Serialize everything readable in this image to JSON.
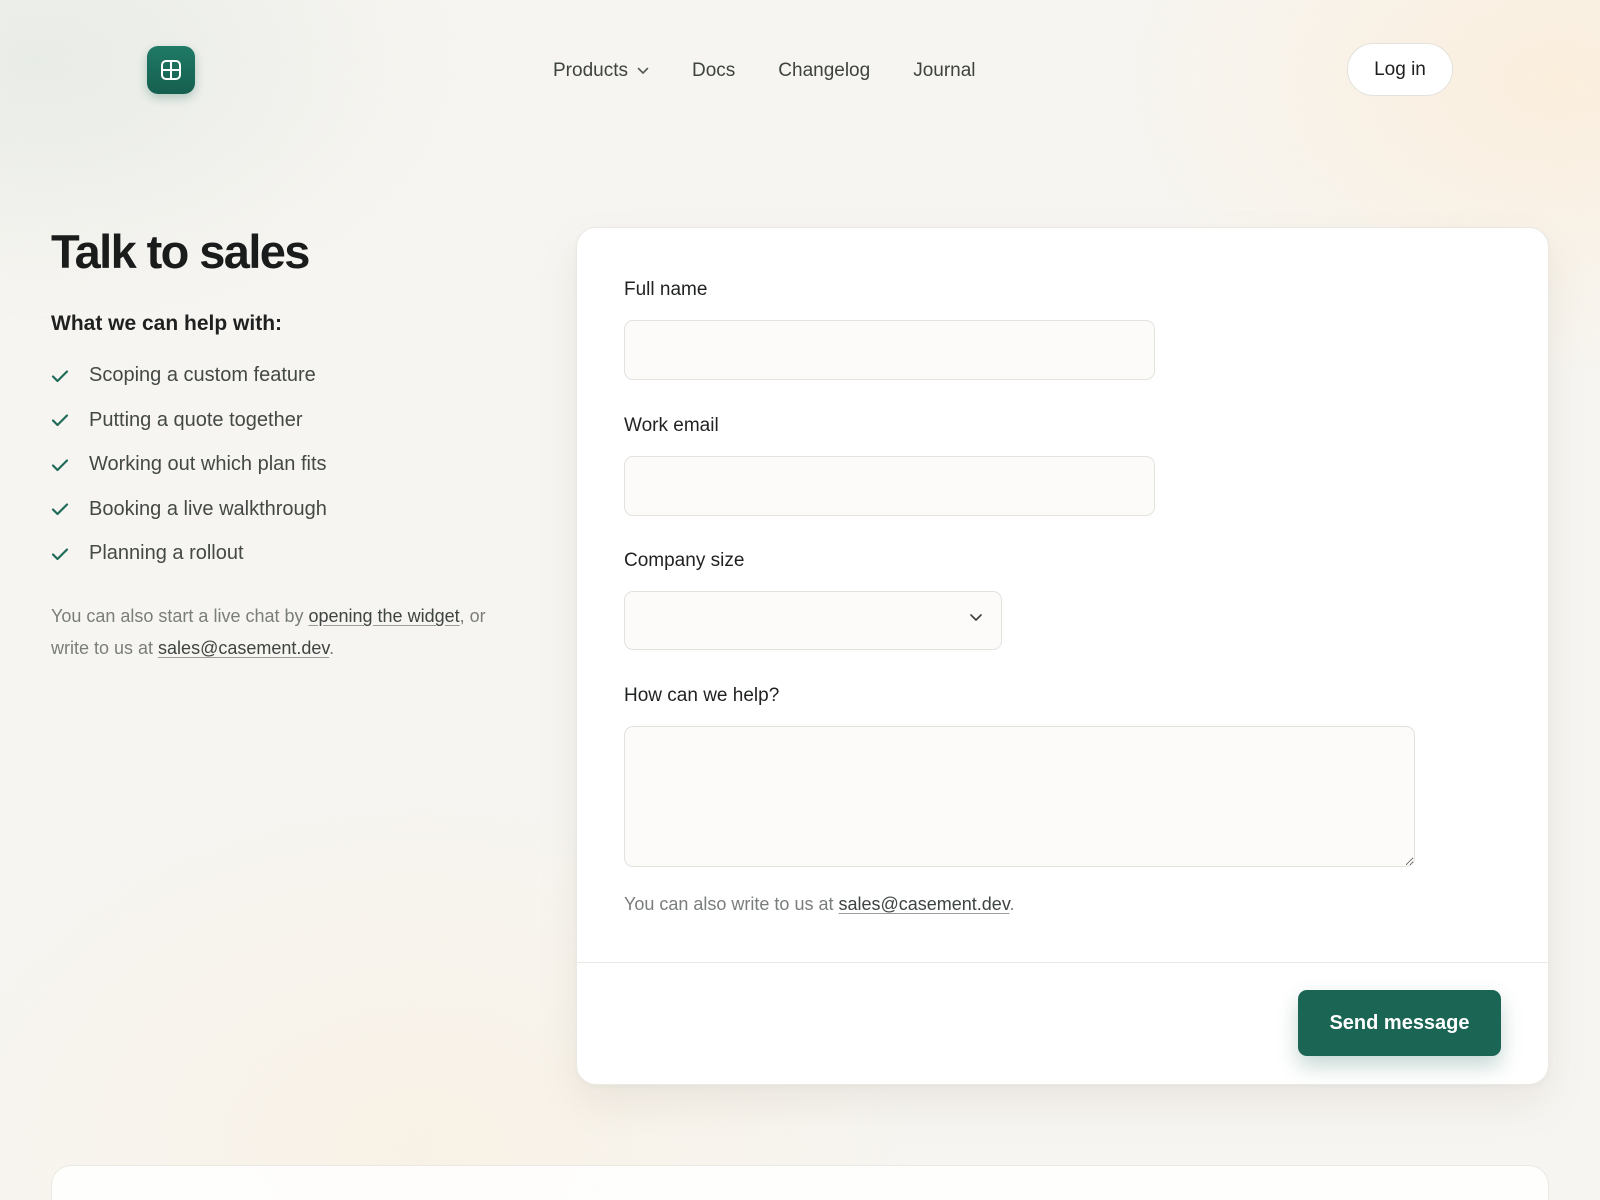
{
  "header": {
    "logo_icon": "grid-window-icon",
    "nav": [
      {
        "label": "Products",
        "has_dropdown": true
      },
      {
        "label": "Docs"
      },
      {
        "label": "Changelog"
      },
      {
        "label": "Journal"
      }
    ],
    "login_label": "Log in"
  },
  "left": {
    "title": "Talk to sales",
    "help_heading": "What we can help with:",
    "help_items": [
      "Scoping a custom feature",
      "Putting a quote together",
      "Working out which plan fits",
      "Booking a live walkthrough",
      "Planning a rollout"
    ],
    "note": {
      "prefix": "You can also start a live chat by ",
      "widget_link": "opening the widget",
      "middle": ", or write to us at ",
      "email_link": "sales@casement.dev",
      "suffix": "."
    }
  },
  "form": {
    "full_name": {
      "label": "Full name",
      "value": "",
      "placeholder": ""
    },
    "work_email": {
      "label": "Work email",
      "value": "",
      "placeholder": ""
    },
    "company_size": {
      "label": "Company size",
      "selected": ""
    },
    "message": {
      "label": "How can we help?",
      "value": "",
      "placeholder": ""
    },
    "note": {
      "prefix": "You can also write to us at ",
      "email_link": "sales@casement.dev",
      "suffix": "."
    },
    "submit_label": "Send message"
  },
  "colors": {
    "brand": "#1a6553",
    "background": "#f7f5f1",
    "card": "#ffffff",
    "check": "#1f6b58"
  }
}
